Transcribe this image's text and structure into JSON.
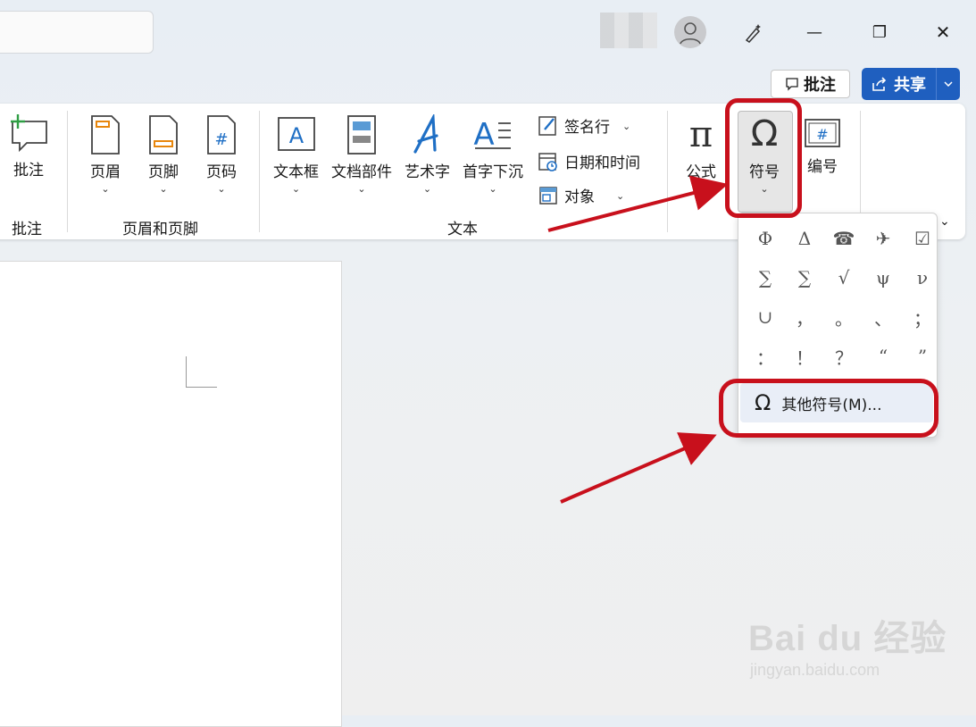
{
  "titlebar": {
    "minimize_glyph": "—",
    "restore_glyph": "❐",
    "close_glyph": "✕"
  },
  "actions": {
    "comment_label": "批注",
    "share_label": "共享"
  },
  "ribbon": {
    "groups": {
      "comments": {
        "label": "批注",
        "button": "批注"
      },
      "header_footer": {
        "label": "页眉和页脚",
        "buttons": [
          "页眉",
          "页脚",
          "页码"
        ]
      },
      "text": {
        "label": "文本",
        "buttons": [
          "文本框",
          "文档部件",
          "艺术字",
          "首字下沉"
        ],
        "small_buttons": [
          "签名行",
          "日期和时间",
          "对象"
        ]
      },
      "symbols": {
        "buttons": [
          "公式",
          "符号",
          "编号"
        ]
      }
    }
  },
  "symbol_dropdown": {
    "symbols": [
      "Φ",
      "Δ",
      "☎",
      "✈",
      "☑",
      "∑",
      "∑",
      "√",
      "ψ",
      "ν",
      "∪",
      "，",
      "。",
      "、",
      "；",
      "：",
      "！",
      "？",
      "“",
      "”"
    ],
    "more_label": "其他符号(M)..."
  },
  "watermark": {
    "brand": "Bai du 经验",
    "url": "jingyan.baidu.com"
  },
  "colors": {
    "accent": "#1f5fbf",
    "annotation_red": "#c8101c"
  }
}
